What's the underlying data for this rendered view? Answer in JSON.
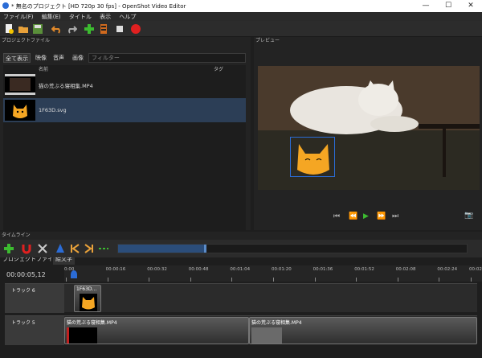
{
  "window": {
    "title": "* 無名のプロジェクト [HD 720p 30 fps] - OpenShot Video Editor",
    "minimize": "—",
    "maximize": "☐",
    "close": "✕"
  },
  "menu": [
    "ファイル(F)",
    "編集(E)",
    "タイトル",
    "表示",
    "ヘルプ"
  ],
  "panels": {
    "project_files_title": "プロジェクトファイル",
    "preview_title": "プレビュー",
    "timeline_title": "タイムライン"
  },
  "filters": {
    "tabs": [
      "全て表示",
      "映像",
      "音声",
      "画像"
    ],
    "placeholder": "フィルター"
  },
  "file_list": {
    "col_name": "名前",
    "col_tag": "タグ",
    "files": [
      {
        "name": "猫の荒ぶる寝相集.MP4",
        "type": "video"
      },
      {
        "name": "1F63D.svg",
        "type": "image",
        "selected": true
      }
    ]
  },
  "bottom_tabs": [
    "プロジェクトファイル",
    "絵文字"
  ],
  "timeline": {
    "timecode": "00:00:05,12",
    "ruler": [
      "0:00",
      "00:00:16",
      "00:00:32",
      "00:00:48",
      "00:01:04",
      "00:01:20",
      "00:01:36",
      "00:01:52",
      "00:02:08",
      "00:02:24",
      "00:02"
    ],
    "tracks": [
      {
        "name": "トラック 6",
        "clips": [
          {
            "label": "1F63D..."
          }
        ]
      },
      {
        "name": "トラック 5",
        "clips": [
          {
            "label": "猫の荒ぶる寝相集.MP4"
          },
          {
            "label": "猫の荒ぶる寝相集.MP4"
          }
        ]
      }
    ]
  },
  "icons": [
    "new-project-icon",
    "open-project-icon",
    "save-project-icon",
    "undo-icon",
    "redo-icon",
    "import-files-icon",
    "profile-icon",
    "fullscreen-icon",
    "export-icon"
  ],
  "colors": {
    "accent": "#2b6cd6",
    "selection": "#2c3e56",
    "record": "#e02020",
    "add": "#3cbb30"
  }
}
